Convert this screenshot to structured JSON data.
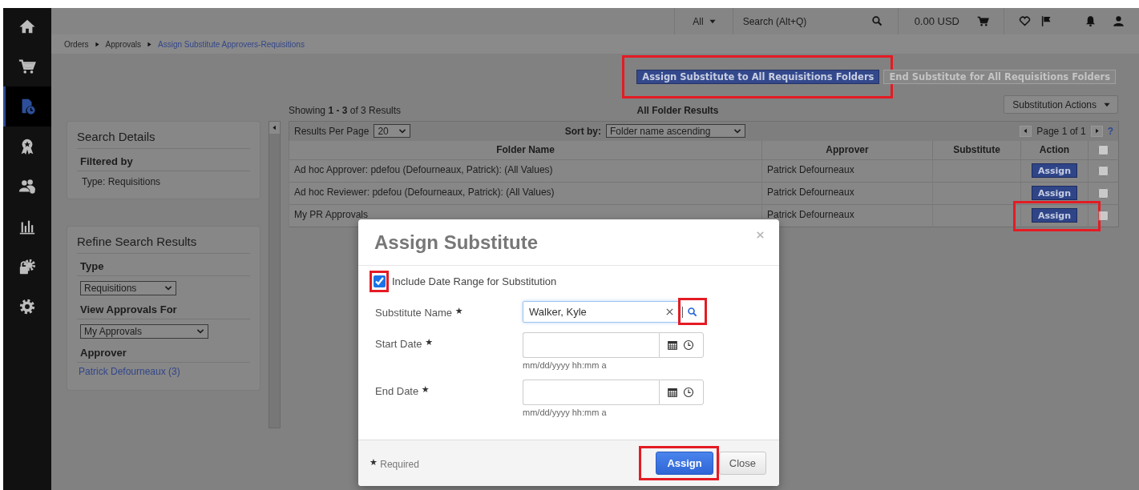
{
  "sidebar": {
    "items": [
      {
        "selected": false
      },
      {
        "selected": false
      },
      {
        "selected": true
      },
      {
        "selected": false
      },
      {
        "selected": false
      },
      {
        "selected": false
      },
      {
        "selected": false
      },
      {
        "selected": false
      }
    ]
  },
  "header": {
    "scope": "All",
    "search_placeholder": "Search (Alt+Q)",
    "cart_total": "0.00 USD"
  },
  "breadcrumb": [
    {
      "label": "Orders",
      "current": false
    },
    {
      "label": "Approvals",
      "current": false
    },
    {
      "label": "Assign Substitute Approvers-Requisitions",
      "current": true
    }
  ],
  "actions": [
    {
      "label": "Assign Substitute to All Requisitions Folders",
      "disabled": false,
      "highlighted": true
    },
    {
      "label": "End Substitute for All Requisitions Folders",
      "disabled": true,
      "highlighted": false
    }
  ],
  "summary": "Showing **1 - 3** of 3 Results",
  "results_title": "All Folder Results",
  "substitution_actions": "Substitution Actions",
  "search_details": {
    "title": "Search Details",
    "sections": [
      {
        "heading": "Filtered by",
        "text": "Type: Requisitions"
      }
    ]
  },
  "refine": {
    "title": "Refine Search Results",
    "filters": [
      {
        "label": "Type",
        "value": "Requisitions"
      },
      {
        "label": "View Approvals For",
        "value": "My Approvals"
      }
    ],
    "approver": {
      "label": "Approver",
      "link": "Patrick Defourneaux (3)"
    }
  },
  "table": {
    "per_page_label": "Results Per Page",
    "per_page": "20",
    "sort_label": "Sort by:",
    "sort": "Folder name ascending",
    "page": "Page 1 of 1",
    "help": "?",
    "columns": [
      "Folder Name",
      "Approver",
      "Substitute",
      "Action"
    ],
    "select_all": false,
    "rows": [
      {
        "folder": "Ad hoc Approver: pdefou (Defourneaux, Patrick): (All Values)",
        "approver": "Patrick Defourneaux",
        "action": "Assign",
        "checked": false,
        "highlighted": false
      },
      {
        "folder": "Ad hoc Reviewer: pdefou (Defourneaux, Patrick): (All Values)",
        "approver": "Patrick Defourneaux",
        "action": "Assign",
        "checked": false,
        "highlighted": false
      },
      {
        "folder": "My PR Approvals",
        "approver": "Patrick Defourneaux",
        "action": "Assign",
        "checked": false,
        "highlighted": true
      }
    ]
  },
  "dialog": {
    "title": "Assign Substitute",
    "include_range": {
      "label": "Include Date Range for Substitution",
      "checked": true,
      "highlighted": true
    },
    "fields": [
      {
        "kind": "lookup",
        "label": "Substitute Name",
        "mark": "★",
        "value": "Walker, Kyle",
        "highlighted": true
      },
      {
        "kind": "date",
        "label": "Start Date",
        "mark": "★",
        "hint": "mm/dd/yyyy hh:mm a"
      },
      {
        "kind": "date",
        "label": "End Date",
        "mark": "★",
        "hint": "mm/dd/yyyy hh:mm a"
      }
    ],
    "required_note": {
      "mark": "★",
      "text": "Required"
    },
    "buttons": [
      {
        "label": "Assign",
        "kind": "primary",
        "highlighted": true
      },
      {
        "label": "Close",
        "kind": "secondary",
        "highlighted": false
      }
    ]
  }
}
